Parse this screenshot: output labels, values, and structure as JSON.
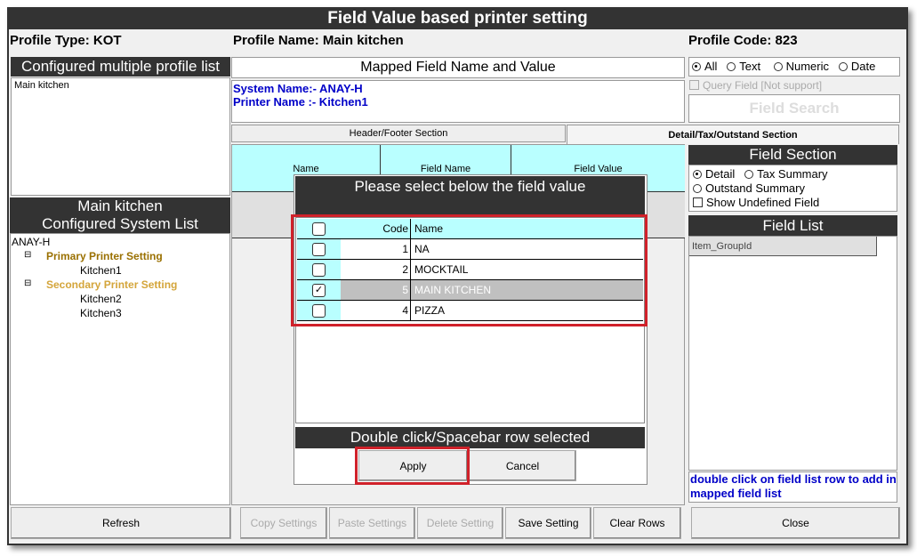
{
  "window": {
    "title": "Field Value based printer setting"
  },
  "profile": {
    "type": "Profile Type: KOT",
    "name": "Profile Name: Main kitchen",
    "code": "Profile Code: 823"
  },
  "left": {
    "profile_list_header": "Configured multiple profile list",
    "profile_list": [
      "Main kitchen"
    ],
    "system_list_header1": "Main kitchen",
    "system_list_header2": "Configured System List",
    "tree": {
      "root": "ANAY-H",
      "primary": "Primary Printer Setting",
      "primary_children": [
        "Kitchen1"
      ],
      "secondary": "Secondary Printer Setting",
      "secondary_children": [
        "Kitchen2",
        "Kitchen3"
      ]
    }
  },
  "middle": {
    "mapped_header": "Mapped Field Name and Value",
    "system_name": "System Name:- ANAY-H",
    "printer_name": "Printer Name :- Kitchen1",
    "tabs": [
      "Header/Footer Section",
      "Detail/Tax/Outstand Section"
    ],
    "grid_columns": [
      "Name",
      "Field Name",
      "Field Value"
    ]
  },
  "right": {
    "filters": [
      "All",
      "Text",
      "Numeric",
      "Date"
    ],
    "filter_selected": "All",
    "query_field": "Query Field [Not support]",
    "field_search": "Field Search",
    "field_section_header": "Field Section",
    "sections": [
      "Detail",
      "Tax Summary",
      "Outstand Summary"
    ],
    "section_selected": "Detail",
    "show_undefined": "Show Undefined Field",
    "field_list_header": "Field List",
    "field_list": [
      "Item_GroupId"
    ],
    "hint": "double click on field list row to add in mapped field list"
  },
  "dialog": {
    "title": "Please select below the field value",
    "columns": [
      "Code",
      "Name"
    ],
    "rows": [
      {
        "code": "1",
        "name": "NA",
        "checked": false
      },
      {
        "code": "2",
        "name": "MOCKTAIL",
        "checked": false
      },
      {
        "code": "5",
        "name": "MAIN KITCHEN",
        "checked": true
      },
      {
        "code": "4",
        "name": "PIZZA",
        "checked": false
      }
    ],
    "footer": "Double click/Spacebar row selected",
    "apply": "Apply",
    "cancel": "Cancel"
  },
  "buttons": {
    "refresh": "Refresh",
    "copy": "Copy Settings",
    "paste": "Paste Settings",
    "delete": "Delete Setting",
    "save": "Save Setting",
    "clear": "Clear Rows",
    "close": "Close"
  },
  "colors": {
    "accent_red": "#d0212a",
    "cyan": "#b9ffff",
    "dark": "#333333",
    "blue_text": "#0000c8",
    "tree_gold": "#9a7000"
  }
}
